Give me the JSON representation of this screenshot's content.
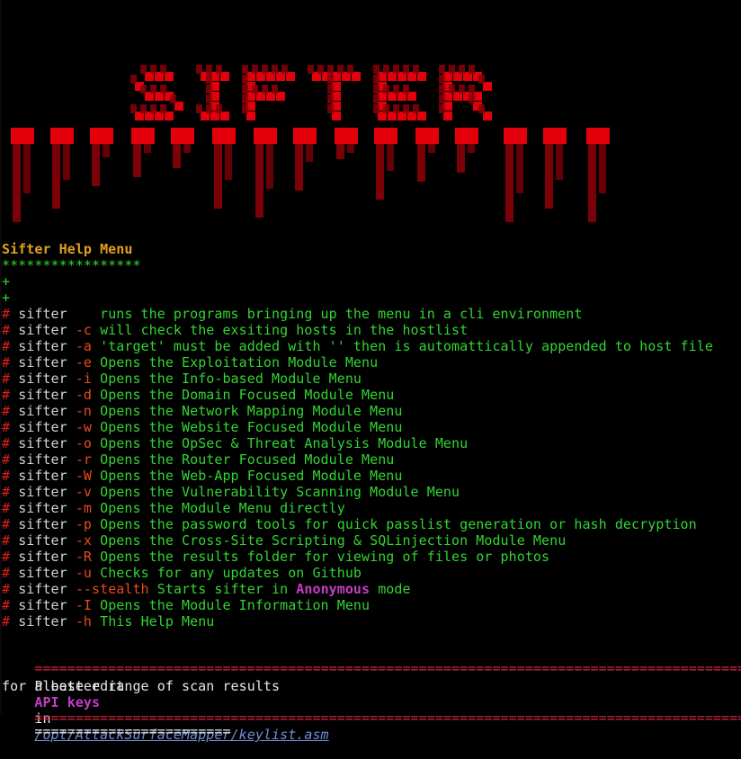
{
  "colors": {
    "background": "#000000",
    "banner_red": "#e4000a",
    "banner_dark_red": "#8a0008",
    "green": "#33d433",
    "gold": "#e0a020",
    "red": "#e0201c",
    "magenta": "#c43ec4",
    "link": "#6f8ed8"
  },
  "banner": {
    "text": "SIFTER"
  },
  "help": {
    "title": "Sifter Help Menu",
    "stars": "*****************",
    "plus1": "+",
    "plus2": "+",
    "hash": "#",
    "cmd": "sifter",
    "rows": [
      {
        "flag": "",
        "desc": "   runs the programs bringing up the menu in a cli environment"
      },
      {
        "flag": "-c",
        "desc": "will check the exsiting hosts in the hostlist"
      },
      {
        "flag": "-a",
        "desc": "'target' must be added with '' then is automattically appended to host file"
      },
      {
        "flag": "-e",
        "desc": "Opens the Exploitation Module Menu"
      },
      {
        "flag": "-i",
        "desc": "Opens the Info-based Module Menu"
      },
      {
        "flag": "-d",
        "desc": "Opens the Domain Focused Module Menu"
      },
      {
        "flag": "-n",
        "desc": "Opens the Network Mapping Module Menu"
      },
      {
        "flag": "-w",
        "desc": "Opens the Website Focused Module Menu"
      },
      {
        "flag": "-o",
        "desc": "Opens the OpSec & Threat Analysis Module Menu"
      },
      {
        "flag": "-r",
        "desc": "Opens the Router Focused Module Menu"
      },
      {
        "flag": "-W",
        "desc": "Opens the Web-App Focused Module Menu"
      },
      {
        "flag": "-v",
        "desc": "Opens the Vulnerability Scanning Module Menu"
      },
      {
        "flag": "-m",
        "desc": "Opens the Module Menu directly"
      },
      {
        "flag": "-p",
        "desc": "Opens the password tools for quick passlist generation or hash decryption"
      },
      {
        "flag": "-x",
        "desc": "Opens the Cross-Site Scripting & SQLinjection Module Menu"
      },
      {
        "flag": "-R",
        "desc": "Opens the results folder for viewing of files or photos"
      },
      {
        "flag": "-u",
        "desc": "Checks for any updates on Github"
      }
    ],
    "stealth": {
      "flag": "--stealth",
      "desc_a": "Starts sifter in",
      "desc_b": "Anonymous",
      "desc_c": "mode"
    },
    "rows_after": [
      {
        "flag": "-I",
        "desc": "Opens the Module Information Menu"
      },
      {
        "flag": "-h",
        "desc": "This Help Menu"
      }
    ]
  },
  "footer": {
    "rule": "==========================================================================================",
    "edit_prefix": "Please edit",
    "api_keys": "API keys",
    "in_word": "in",
    "path": "/opt/AttackSurfaceMapper/keylist.asm",
    "scan_line": "for a better range of scan results",
    "bottom_rule": "========================"
  }
}
